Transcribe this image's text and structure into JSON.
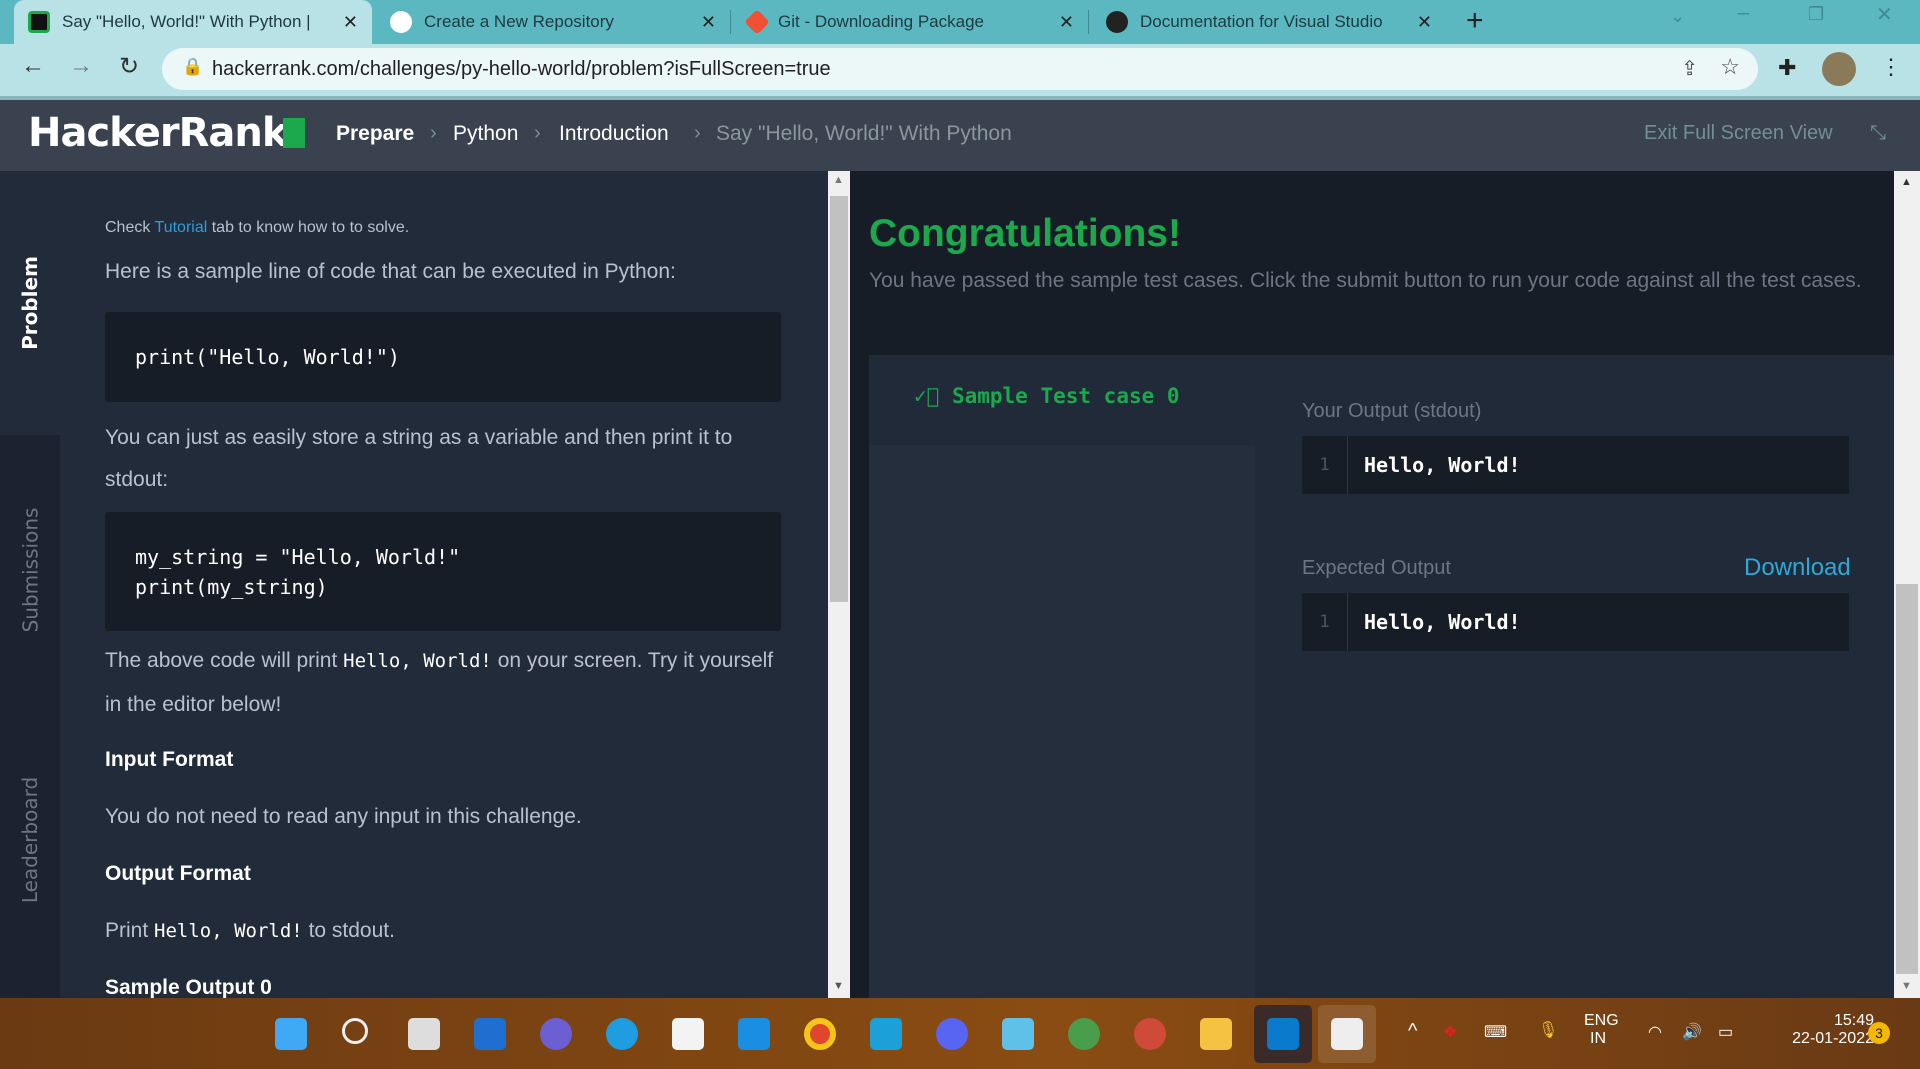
{
  "browser": {
    "tabs": [
      {
        "title": "Say \"Hello, World!\" With Python |",
        "active": true,
        "icon": "hackerrank-icon",
        "color": "#1ba94c"
      },
      {
        "title": "Create a New Repository",
        "active": false,
        "icon": "github-icon",
        "color": "#ffffff"
      },
      {
        "title": "Git - Downloading Package",
        "active": false,
        "icon": "git-icon",
        "color": "#f05033"
      },
      {
        "title": "Documentation for Visual Studio",
        "active": false,
        "icon": "globe-icon",
        "color": "#222222"
      }
    ],
    "new_tab": "+",
    "url": "hackerrank.com/challenges/py-hello-world/problem?isFullScreen=true"
  },
  "header": {
    "logo": "HackerRank",
    "breadcrumbs": [
      "Prepare",
      "Python",
      "Introduction",
      "Say \"Hello, World!\" With Python"
    ],
    "exit_fullscreen": "Exit Full Screen View"
  },
  "sidebar": {
    "tabs": [
      "Problem",
      "Submissions",
      "Leaderboard"
    ],
    "active": "Problem"
  },
  "problem": {
    "check_pre": "Check ",
    "check_link": "Tutorial",
    "check_post": " tab to know how to to solve.",
    "p1": "Here is a sample line of code that can be executed in Python:",
    "code1": "print(\"Hello, World!\")",
    "p2": "You can just as easily store a string as a variable and then print it to stdout:",
    "code2_line1": "my_string = \"Hello, World!\"",
    "code2_line2": "print(my_string)",
    "p3_pre": "The above code will print ",
    "p3_code": "Hello, World!",
    "p3_post": " on your screen. Try it yourself in the editor below!",
    "input_format_title": "Input Format",
    "input_format": "You do not need to read any input in this challenge.",
    "output_format_title": "Output Format",
    "output_pre": "Print ",
    "output_code": "Hello, World!",
    "output_post": " to stdout.",
    "sample_output_title": "Sample Output 0"
  },
  "result": {
    "title": "Congratulations!",
    "message": "You have passed the sample test cases. Click the submit button to run your code against all the test cases.",
    "test_case": "Sample Test case 0",
    "your_output_label": "Your Output (stdout)",
    "your_output_line": "1",
    "your_output": "Hello, World!",
    "expected_label": "Expected Output",
    "download": "Download",
    "expected_line": "1",
    "expected": "Hello, World!",
    "success_color": "#1ba94c"
  },
  "taskbar": {
    "lang": "ENG",
    "region": "IN",
    "time": "15:49",
    "date": "22-01-2022",
    "notifications": "3"
  }
}
